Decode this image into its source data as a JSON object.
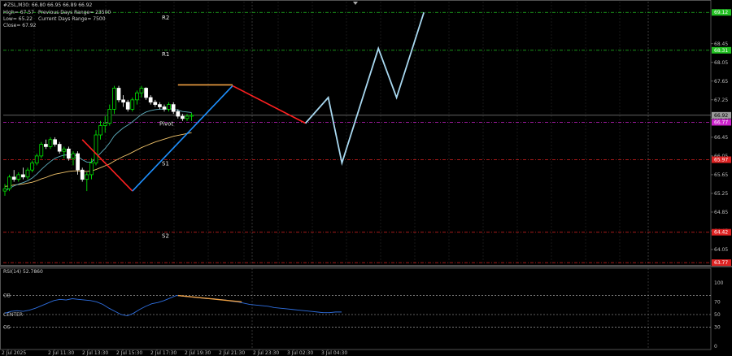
{
  "info": {
    "symbol_line": "#ZSL,M30: 66.80 66.95 66.89 66.92",
    "prev_days_range": "Previous Days Range= 23500",
    "current_days_range": "Current Days Range= 7500",
    "high": "High= 67.57",
    "low": "Low= 65.22",
    "close": "Close= 67.92"
  },
  "pivot_labels": {
    "r2": "R2",
    "r1": "R1",
    "pivot": "Pivot",
    "s1": "S1",
    "s2": "S2"
  },
  "rsi_label": "RSI(14) 52.7860",
  "rsi_levels": {
    "ob": "OB",
    "center": "CENTER",
    "os": "OS"
  },
  "colors": {
    "background": "#000000",
    "bull_candle": "#00ff00",
    "bear_candle": "#ffffff",
    "ema_fast": "#5fb0c0",
    "ema_slow": "#f0c36a",
    "zigzag_red": "#ff2020",
    "zigzag_blue": "#1e90ff",
    "projection": "#a8d8f0",
    "r_levels": "#22c022",
    "s_levels": "#dd2222",
    "pivot_level": "#cc22cc",
    "rsi_line": "#2f6fe0",
    "rsi_divergence": "#f0a040"
  },
  "chart_data": [
    {
      "type": "candlestick",
      "symbol": "#ZSL",
      "timeframe": "M30",
      "x_ticks": [
        "2 Jul 2025",
        "2 Jul 11:30",
        "2 Jul 13:30",
        "2 Jul 15:30",
        "2 Jul 17:30",
        "2 Jul 19:30",
        "2 Jul 21:30",
        "2 Jul 23:30",
        "3 Jul 02:30",
        "3 Jul 04:30"
      ],
      "y_ticks": [
        "68.45",
        "68.05",
        "67.65",
        "67.25",
        "66.85",
        "66.45",
        "66.05",
        "65.65",
        "65.25",
        "64.85",
        "64.45",
        "64.05"
      ],
      "ylim": [
        63.72,
        69.35
      ],
      "levels": [
        {
          "name": "R2",
          "value": 69.12,
          "label": "69.12",
          "kind": "r"
        },
        {
          "name": "R1",
          "value": 68.31,
          "label": "68.31",
          "kind": "r"
        },
        {
          "name": "current",
          "value": 66.92,
          "label": "66.92",
          "kind": "current"
        },
        {
          "name": "Pivot",
          "value": 66.77,
          "label": "66.77",
          "kind": "pivot"
        },
        {
          "name": "S1",
          "value": 65.97,
          "label": "65.97",
          "kind": "s"
        },
        {
          "name": "S2",
          "value": 64.42,
          "label": "64.42",
          "kind": "s"
        },
        {
          "name": "S3",
          "value": 63.77,
          "label": "63.77",
          "kind": "s"
        }
      ],
      "candles": [
        [
          65.3,
          65.45,
          65.2,
          65.35
        ],
        [
          65.35,
          65.65,
          65.3,
          65.6
        ],
        [
          65.6,
          65.75,
          65.5,
          65.55
        ],
        [
          65.55,
          65.7,
          65.5,
          65.65
        ],
        [
          65.65,
          65.8,
          65.55,
          65.6
        ],
        [
          65.6,
          65.8,
          65.55,
          65.75
        ],
        [
          65.75,
          65.95,
          65.7,
          65.9
        ],
        [
          65.9,
          66.1,
          65.85,
          66.05
        ],
        [
          66.05,
          66.35,
          66.0,
          66.3
        ],
        [
          66.3,
          66.4,
          66.2,
          66.25
        ],
        [
          66.25,
          66.45,
          66.2,
          66.4
        ],
        [
          66.4,
          66.45,
          66.25,
          66.3
        ],
        [
          66.3,
          66.35,
          66.1,
          66.15
        ],
        [
          66.15,
          66.25,
          66.0,
          66.2
        ],
        [
          66.2,
          66.25,
          65.95,
          66.0
        ],
        [
          66.0,
          66.15,
          65.85,
          66.1
        ],
        [
          66.1,
          66.15,
          65.65,
          65.75
        ],
        [
          65.75,
          65.8,
          65.5,
          65.55
        ],
        [
          65.55,
          65.7,
          65.3,
          65.65
        ],
        [
          65.65,
          66.0,
          65.55,
          65.9
        ],
        [
          65.9,
          66.6,
          65.85,
          66.5
        ],
        [
          66.5,
          66.8,
          66.4,
          66.7
        ],
        [
          66.7,
          66.9,
          66.55,
          66.75
        ],
        [
          66.75,
          67.15,
          66.7,
          67.05
        ],
        [
          67.05,
          67.55,
          66.95,
          67.5
        ],
        [
          67.5,
          67.55,
          67.2,
          67.25
        ],
        [
          67.25,
          67.35,
          67.1,
          67.2
        ],
        [
          67.2,
          67.25,
          67.0,
          67.05
        ],
        [
          67.05,
          67.3,
          67.0,
          67.25
        ],
        [
          67.25,
          67.45,
          67.15,
          67.4
        ],
        [
          67.4,
          67.55,
          67.3,
          67.5
        ],
        [
          67.5,
          67.52,
          67.25,
          67.3
        ],
        [
          67.3,
          67.35,
          67.15,
          67.2
        ],
        [
          67.2,
          67.25,
          67.1,
          67.15
        ],
        [
          67.15,
          67.2,
          67.05,
          67.1
        ],
        [
          67.1,
          67.15,
          67.0,
          67.05
        ],
        [
          67.05,
          67.2,
          67.0,
          67.15
        ],
        [
          67.15,
          67.2,
          66.95,
          67.0
        ],
        [
          67.0,
          67.05,
          66.85,
          66.9
        ],
        [
          66.9,
          66.95,
          66.8,
          66.85
        ],
        [
          66.85,
          66.95,
          66.8,
          66.9
        ],
        [
          66.9,
          66.97,
          66.8,
          66.92
        ]
      ],
      "ema_fast": [
        65.3,
        65.36,
        65.41,
        65.45,
        65.48,
        65.52,
        65.58,
        65.66,
        65.76,
        65.85,
        65.93,
        66.0,
        66.04,
        66.07,
        66.07,
        66.08,
        66.04,
        65.97,
        65.92,
        65.92,
        66.01,
        66.11,
        66.21,
        66.33,
        66.48,
        66.57,
        66.65,
        66.71,
        66.78,
        66.86,
        66.94,
        66.99,
        67.02,
        67.04,
        67.05,
        67.05,
        67.06,
        67.05,
        67.03,
        67.0,
        66.99,
        66.98
      ],
      "ema_slow": [
        65.4,
        65.41,
        65.43,
        65.44,
        65.45,
        65.47,
        65.49,
        65.52,
        65.56,
        65.59,
        65.63,
        65.66,
        65.68,
        65.7,
        65.72,
        65.73,
        65.73,
        65.72,
        65.72,
        65.73,
        65.76,
        65.8,
        65.84,
        65.88,
        65.94,
        65.99,
        66.04,
        66.08,
        66.13,
        66.18,
        66.23,
        66.27,
        66.31,
        66.35,
        66.38,
        66.41,
        66.44,
        66.47,
        66.49,
        66.51,
        66.53,
        66.55
      ],
      "zigzag": [
        {
          "from": [
            17,
            66.4
          ],
          "to": [
            28,
            65.3
          ],
          "color": "zigzag_red"
        },
        {
          "from": [
            28,
            65.3
          ],
          "to": [
            50,
            67.55
          ],
          "color": "zigzag_blue"
        },
        {
          "from": [
            50,
            67.55
          ],
          "to": [
            66,
            66.75
          ],
          "color": "zigzag_red"
        },
        {
          "from": [
            38,
            67.57
          ],
          "to": [
            50,
            67.57
          ],
          "color": "rsi_divergence"
        }
      ],
      "projection": [
        [
          66,
          66.75
        ],
        [
          71,
          67.3
        ],
        [
          74,
          65.9
        ],
        [
          82,
          68.35
        ],
        [
          86,
          67.3
        ],
        [
          92,
          69.12
        ]
      ]
    },
    {
      "type": "line",
      "name": "RSI(14)",
      "ylim": [
        0,
        100
      ],
      "y_ticks": [
        "100",
        "70",
        "50",
        "30",
        "0"
      ],
      "levels": {
        "ob": 80,
        "center": 50,
        "os": 30
      },
      "values": [
        52,
        55,
        56,
        55,
        57,
        60,
        64,
        68,
        72,
        74,
        73,
        75,
        74,
        73,
        72,
        70,
        66,
        60,
        55,
        50,
        48,
        52,
        58,
        63,
        67,
        69,
        72,
        76,
        80,
        79,
        78,
        77,
        76,
        75,
        75,
        74,
        73,
        71,
        70,
        68,
        66,
        65,
        64,
        63,
        61,
        60,
        59,
        58,
        57,
        56,
        55,
        54,
        53,
        53,
        54,
        54
      ],
      "divergence": [
        [
          38,
          80
        ],
        [
          52,
          70
        ]
      ],
      "value_label": "52.7860"
    }
  ]
}
